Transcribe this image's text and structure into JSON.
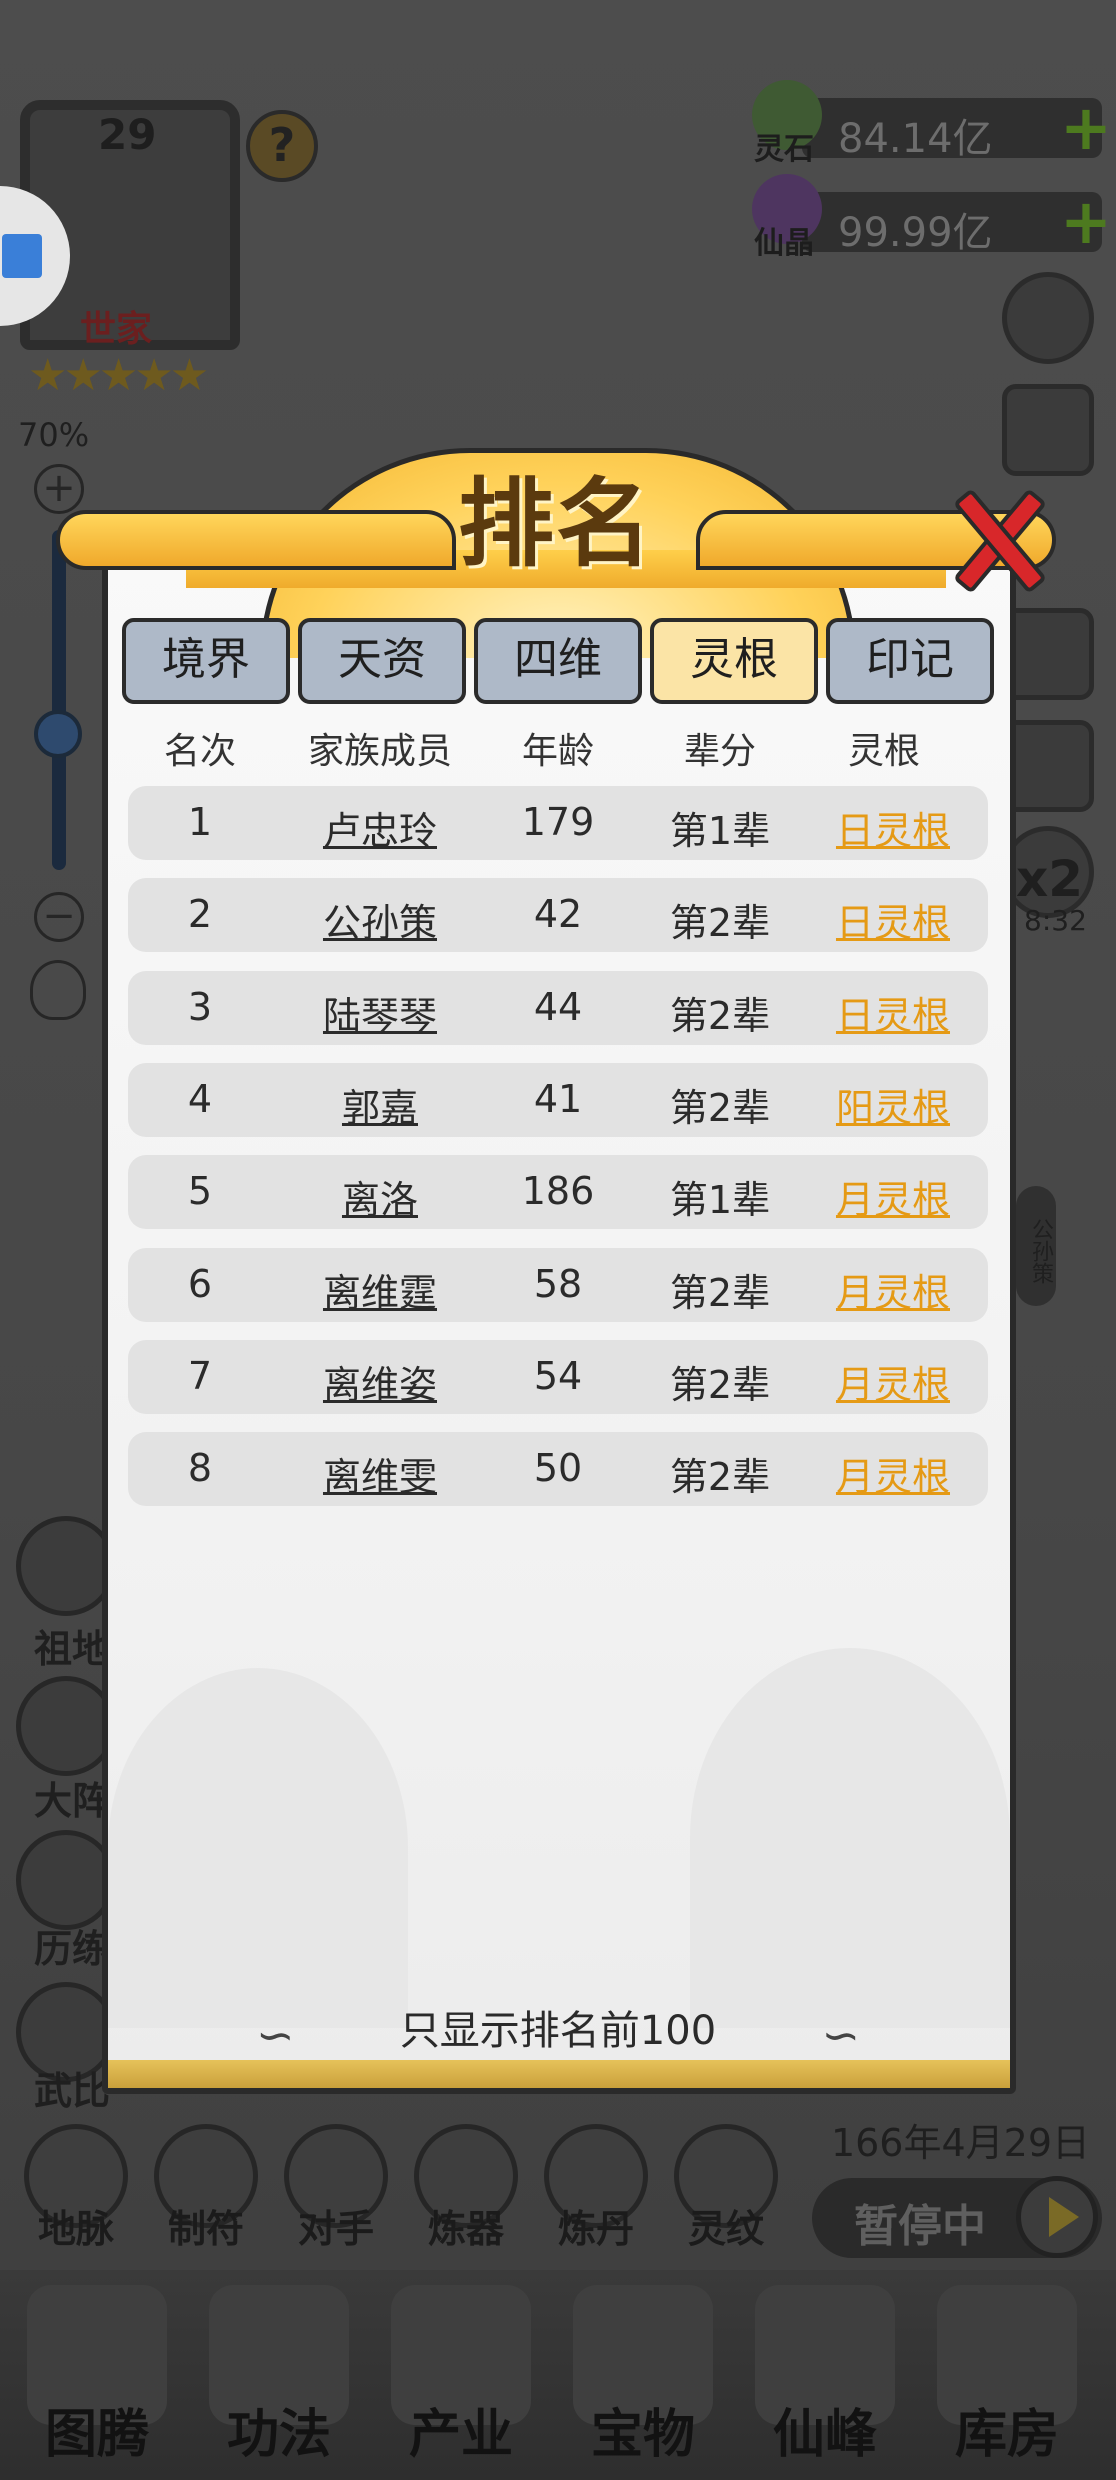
{
  "hud": {
    "level": "29",
    "help": "?",
    "clan_tier": "世家",
    "stars": "★★★★★",
    "zoom_percent": "70%",
    "zoom_in": "+",
    "zoom_out": "−"
  },
  "resources": [
    {
      "label": "灵石",
      "value": "84.14亿",
      "plus": "+",
      "color": "#4a6a3a"
    },
    {
      "label": "仙晶",
      "value": "99.99亿",
      "plus": "+",
      "color": "#5a3a6a"
    }
  ],
  "side_overlap": {
    "speed_label": "x2",
    "speed_timer": "8:32",
    "badge_text": "公孙策"
  },
  "left_menu": [
    {
      "label": "祖地"
    },
    {
      "label": "大阵"
    },
    {
      "label": "历练"
    },
    {
      "label": "武比"
    }
  ],
  "toolbar": [
    {
      "label": "地脉"
    },
    {
      "label": "制符"
    },
    {
      "label": "对手"
    },
    {
      "label": "炼器"
    },
    {
      "label": "炼丹"
    },
    {
      "label": "灵纹"
    }
  ],
  "game_date": "166年4月29日",
  "pause_label": "暂停中",
  "bottom_nav": [
    {
      "label": "图腾"
    },
    {
      "label": "功法"
    },
    {
      "label": "产业"
    },
    {
      "label": "宝物"
    },
    {
      "label": "仙峰"
    },
    {
      "label": "库房"
    }
  ],
  "dialog": {
    "title": "排名",
    "tabs": [
      {
        "label": "境界",
        "active": false
      },
      {
        "label": "天资",
        "active": false
      },
      {
        "label": "四维",
        "active": false
      },
      {
        "label": "灵根",
        "active": true
      },
      {
        "label": "印记",
        "active": false
      }
    ],
    "columns": [
      "名次",
      "家族成员",
      "年龄",
      "辈分",
      "灵根"
    ],
    "rows": [
      {
        "rank": "1",
        "name": "卢忠玲",
        "age": "179",
        "generation": "第1辈",
        "root": "日灵根"
      },
      {
        "rank": "2",
        "name": "公孙策",
        "age": "42",
        "generation": "第2辈",
        "root": "日灵根"
      },
      {
        "rank": "3",
        "name": "陆琴琴",
        "age": "44",
        "generation": "第2辈",
        "root": "日灵根"
      },
      {
        "rank": "4",
        "name": "郭嘉",
        "age": "41",
        "generation": "第2辈",
        "root": "阳灵根"
      },
      {
        "rank": "5",
        "name": "离洛",
        "age": "186",
        "generation": "第1辈",
        "root": "月灵根"
      },
      {
        "rank": "6",
        "name": "离维霆",
        "age": "58",
        "generation": "第2辈",
        "root": "月灵根"
      },
      {
        "rank": "7",
        "name": "离维姿",
        "age": "54",
        "generation": "第2辈",
        "root": "月灵根"
      },
      {
        "rank": "8",
        "name": "离维雯",
        "age": "50",
        "generation": "第2辈",
        "root": "月灵根"
      }
    ],
    "footer": "只显示排名前100"
  }
}
